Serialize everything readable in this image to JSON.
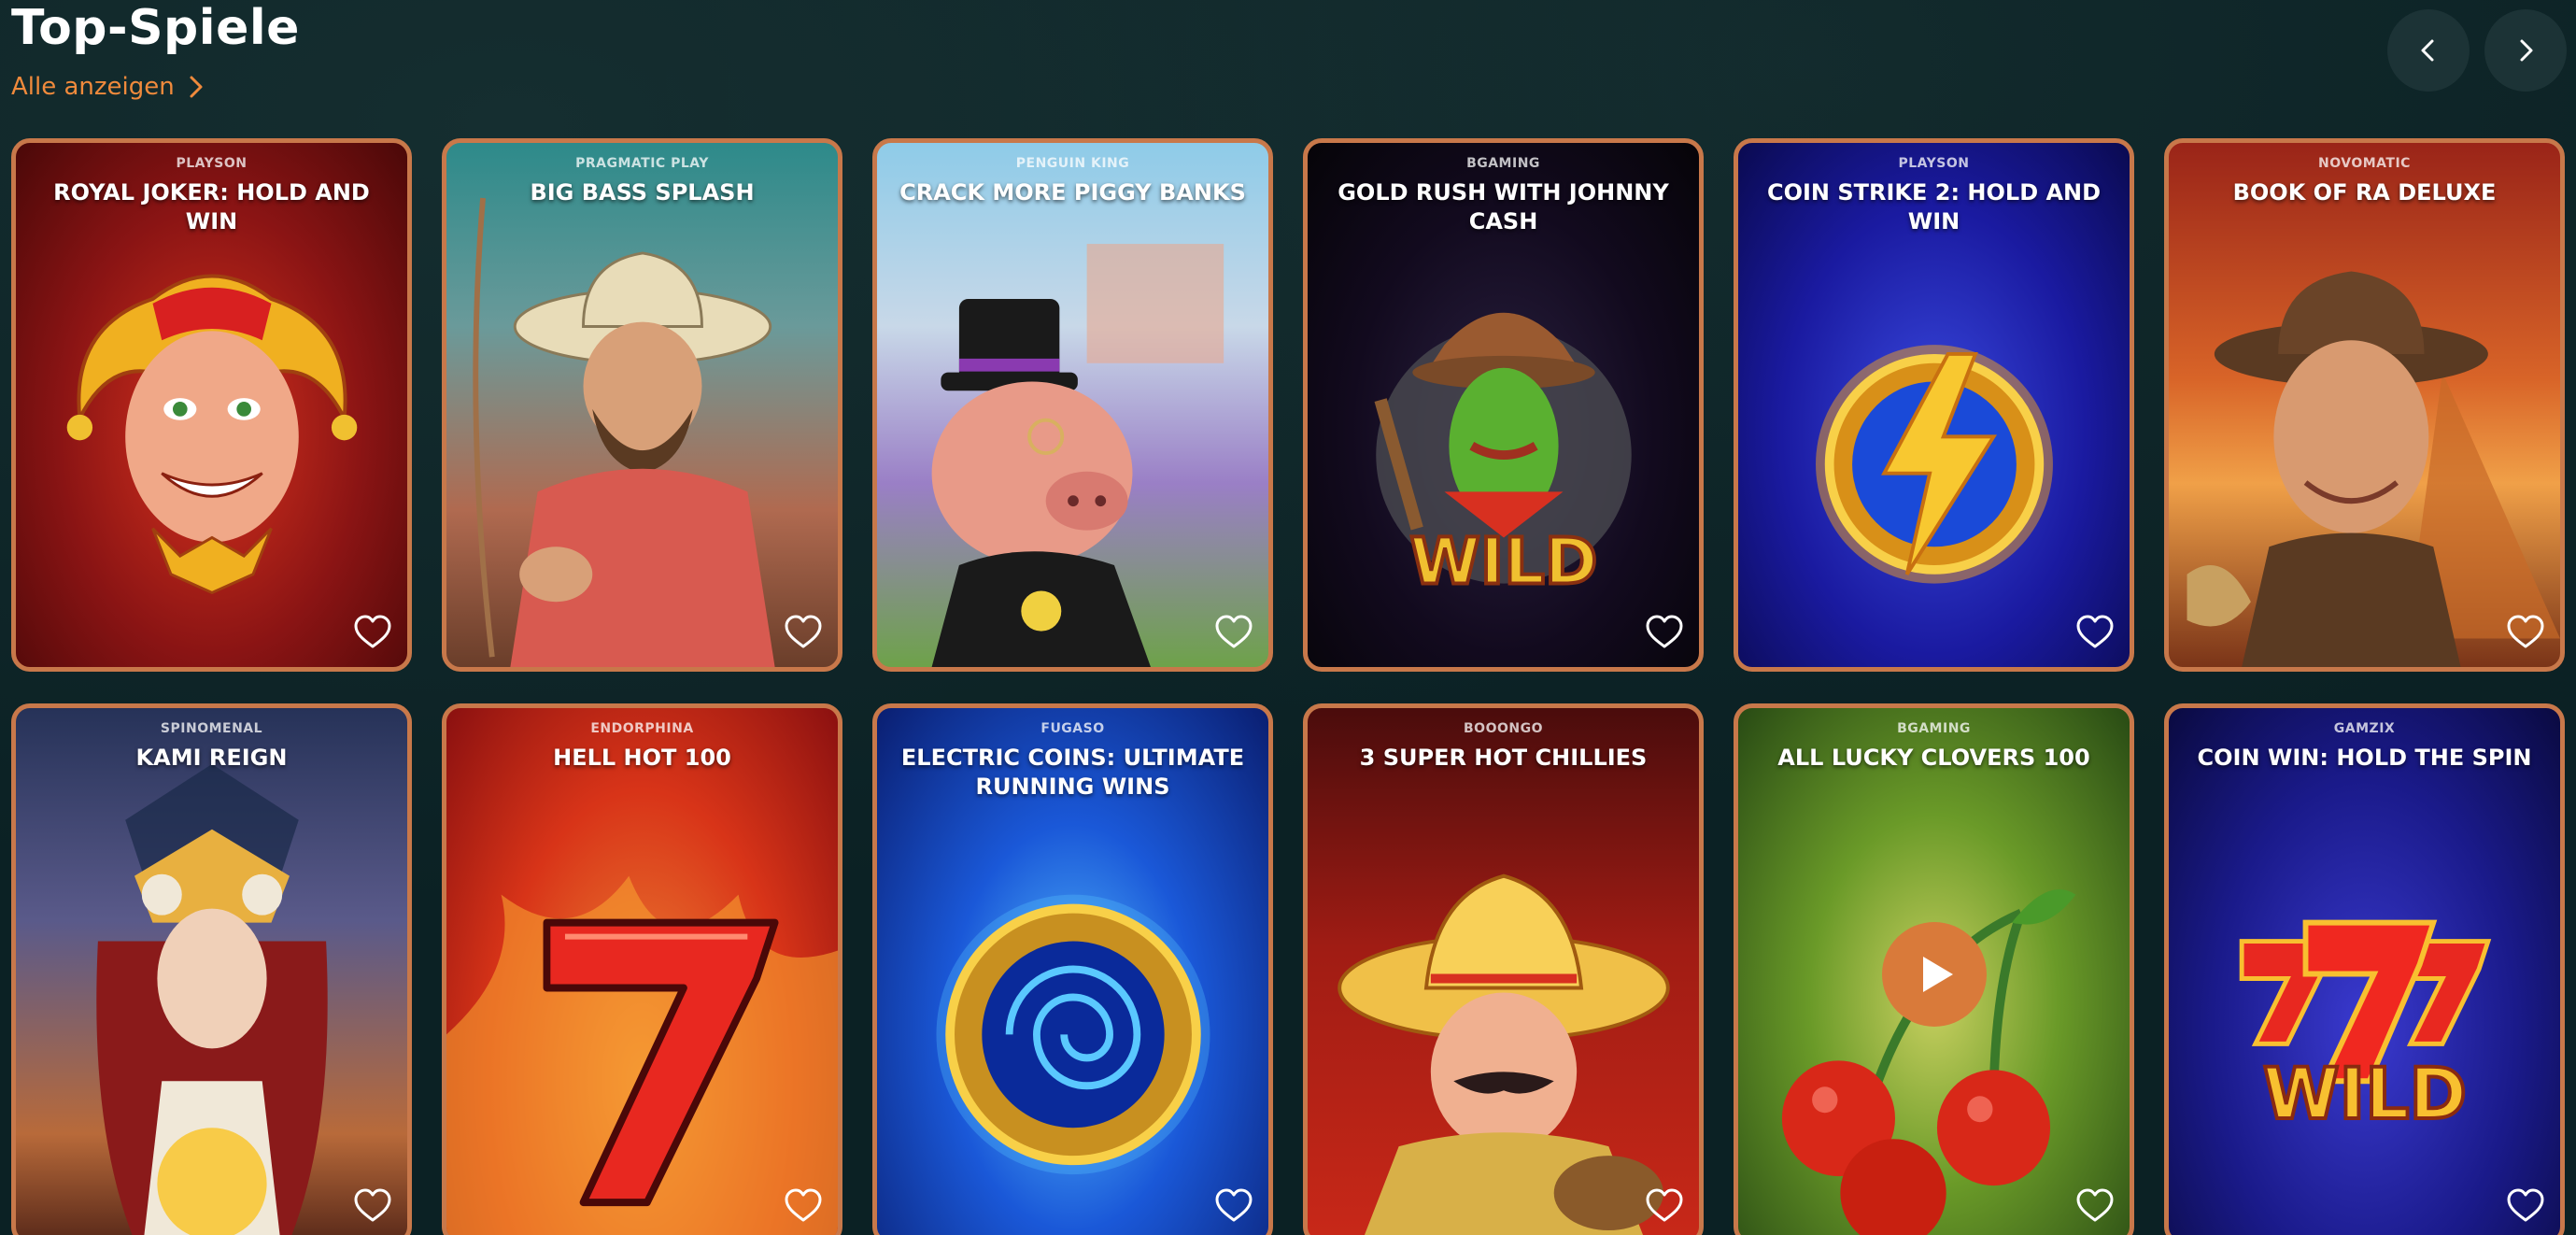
{
  "section": {
    "title": "Top-Spiele",
    "see_all_label": "Alle anzeigen"
  },
  "navigation": {
    "prev_icon": "chevron-left-icon",
    "next_icon": "chevron-right-icon"
  },
  "colors": {
    "background": "#0b2124",
    "accent": "#f08a3c",
    "card_border": "#c8784a",
    "nav_button": "#1c3336",
    "play_button": "#d97a3a"
  },
  "games": [
    {
      "provider": "PLAYSON",
      "title": "ROYAL JOKER: HOLD AND WIN",
      "art": "jester-face"
    },
    {
      "provider": "PRAGMATIC PLAY",
      "title": "BIG BASS SPLASH",
      "art": "fisherman"
    },
    {
      "provider": "PENGUIN KING",
      "title": "CRACK MORE PIGGY BANKS",
      "art": "pig-with-top-hat"
    },
    {
      "provider": "BGAMING",
      "title": "GOLD RUSH WITH JOHNNY CASH",
      "art": "cactus-wild"
    },
    {
      "provider": "PLAYSON",
      "title": "COIN STRIKE 2: HOLD AND WIN",
      "art": "lightning-coin"
    },
    {
      "provider": "NOVOMATIC",
      "title": "BOOK OF RA DELUXE",
      "art": "explorer"
    },
    {
      "provider": "SPINOMENAL",
      "title": "KAMI REIGN",
      "art": "goddess"
    },
    {
      "provider": "ENDORPHINA",
      "title": "HELL HOT 100",
      "art": "flaming-seven"
    },
    {
      "provider": "FUGASO",
      "title": "ELECTRIC COINS: ULTIMATE RUNNING WINS",
      "art": "electric-coin"
    },
    {
      "provider": "BOOONGO",
      "title": "3 SUPER HOT CHILLIES",
      "art": "mariachi"
    },
    {
      "provider": "BGAMING",
      "title": "ALL LUCKY CLOVERS 100",
      "art": "cherries",
      "hover_play": true
    },
    {
      "provider": "GAMZIX",
      "title": "COIN WIN: HOLD THE SPIN",
      "art": "seven-wild"
    }
  ]
}
